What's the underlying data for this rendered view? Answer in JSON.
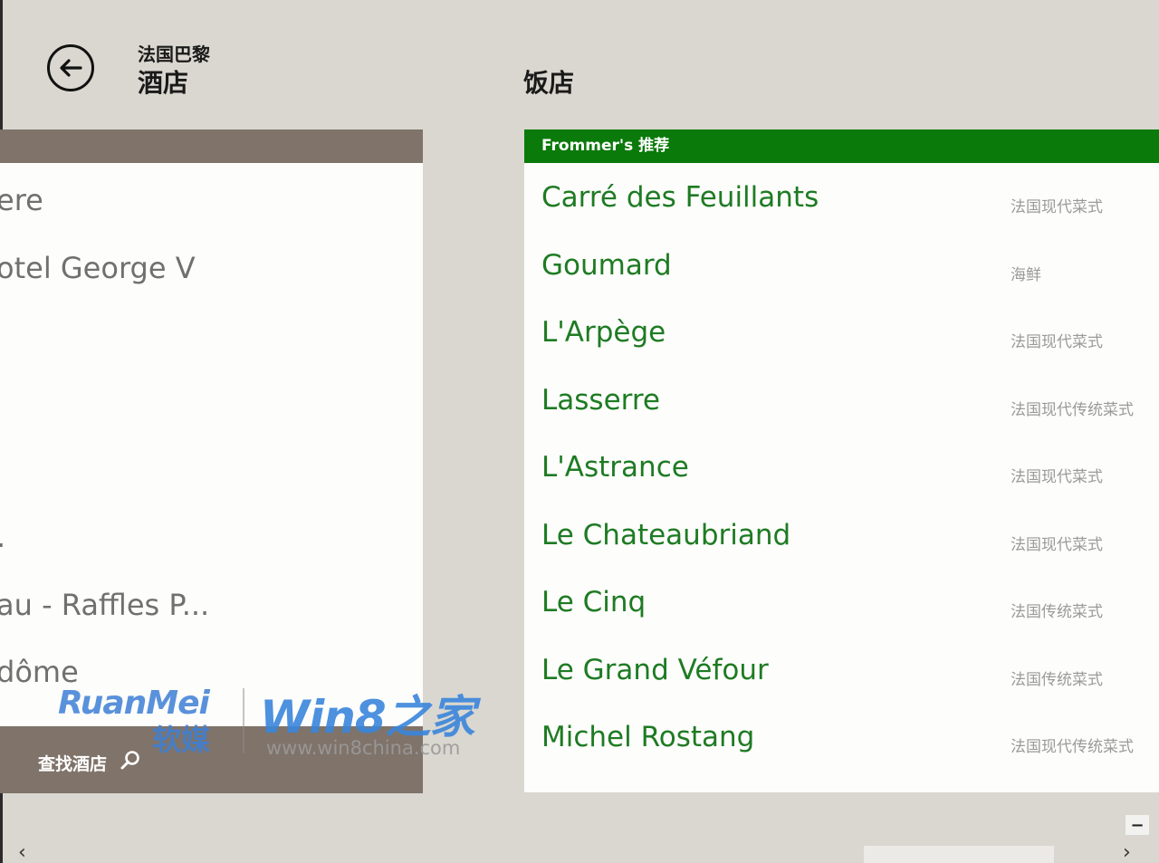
{
  "header": {
    "subtitle": "法国巴黎",
    "title": "酒店",
    "back_icon": "back-arrow-icon"
  },
  "hotels": {
    "items": [
      "ere",
      "otel George V",
      ".",
      "au - Raffles P...",
      "dôme"
    ],
    "search_label": "查找酒店",
    "search_icon": "search-icon"
  },
  "restaurants": {
    "section_title": "饭店",
    "header": "Frommer's 推荐",
    "items": [
      {
        "name": "Carré des Feuillants",
        "cuisine": "法国现代菜式"
      },
      {
        "name": "Goumard",
        "cuisine": "海鲜"
      },
      {
        "name": "L'Arpège",
        "cuisine": "法国现代菜式"
      },
      {
        "name": "Lasserre",
        "cuisine": "法国现代传统菜式"
      },
      {
        "name": "L'Astrance",
        "cuisine": "法国现代菜式"
      },
      {
        "name": "Le Chateaubriand",
        "cuisine": "法国现代菜式"
      },
      {
        "name": "Le Cinq",
        "cuisine": "法国传统菜式"
      },
      {
        "name": "Le Grand Véfour",
        "cuisine": "法国传统菜式"
      },
      {
        "name": "Michel Rostang",
        "cuisine": "法国现代传统菜式"
      }
    ]
  },
  "watermark": {
    "brand1_latin": "RuanMei",
    "brand1_cn": "软媒",
    "brand2": "Win8之家",
    "url": "www.win8china.com"
  },
  "controls": {
    "minus_label": "−",
    "scroll_left": "‹",
    "scroll_right": "›"
  },
  "colors": {
    "background": "#d9d7cf",
    "hotel_bar": "#7f736a",
    "accent_green": "#0a7a0a",
    "restaurant_text": "#1e7b23"
  }
}
